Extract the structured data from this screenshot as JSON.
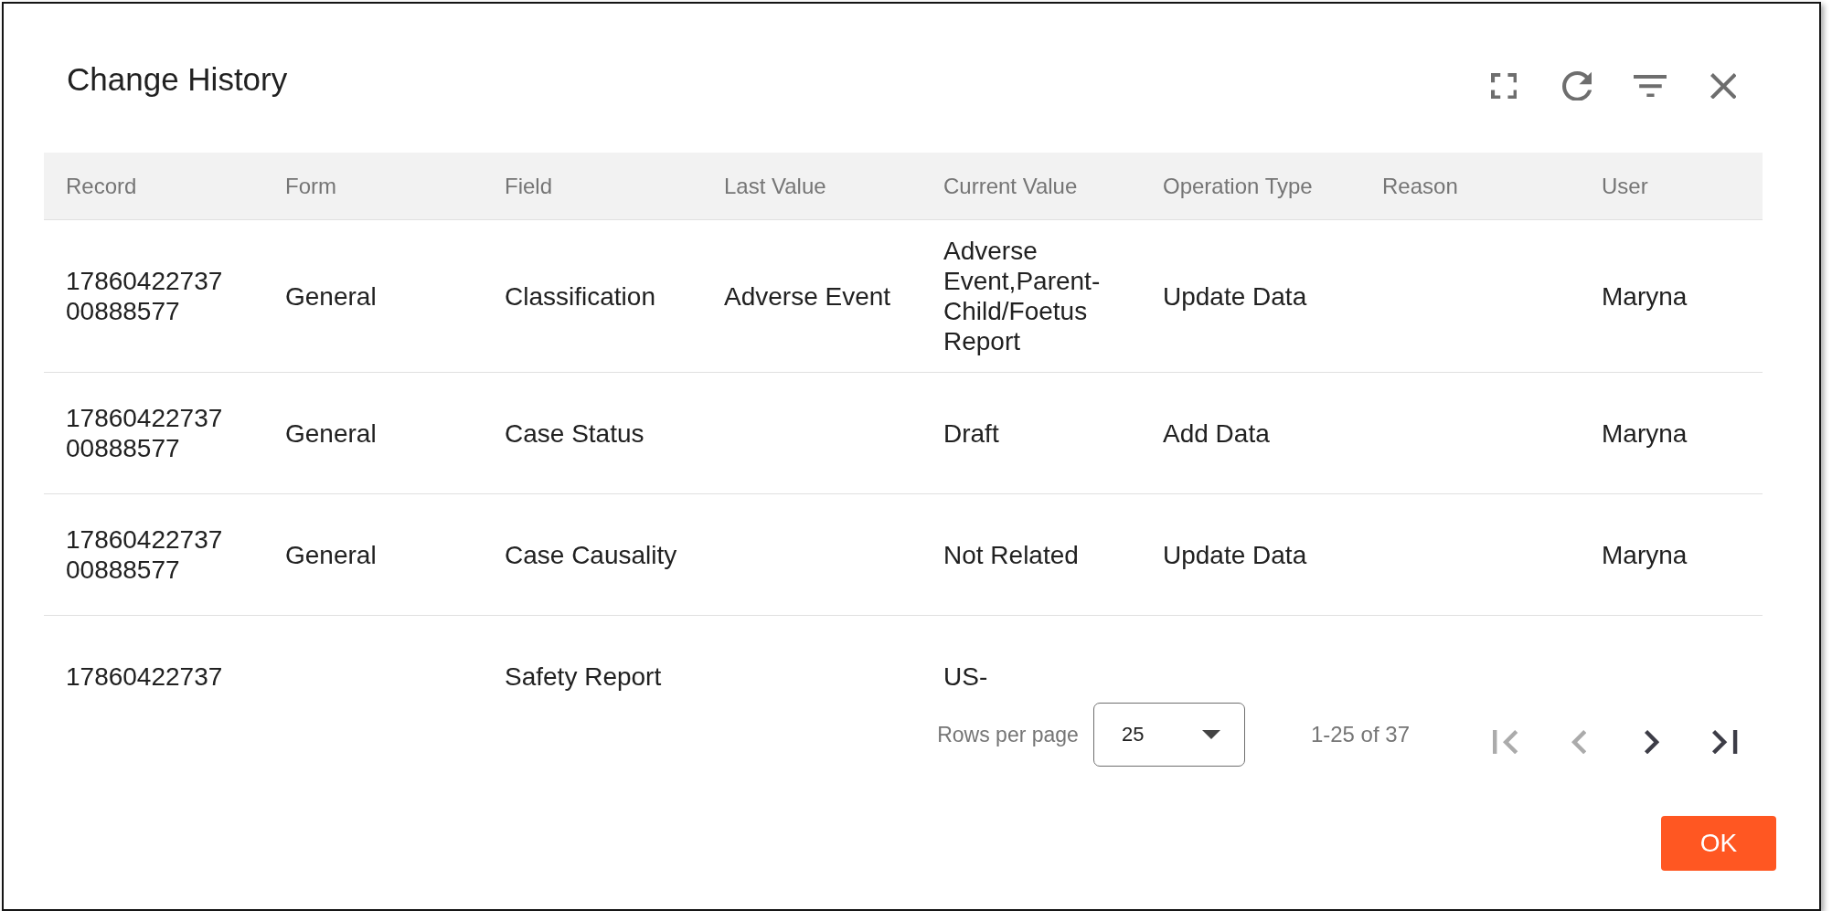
{
  "dialog": {
    "title": "Change History",
    "toolbar": [
      {
        "kind": "fullscreen"
      },
      {
        "kind": "refresh"
      },
      {
        "kind": "filter"
      },
      {
        "kind": "close"
      }
    ]
  },
  "table": {
    "columns": [
      "Record",
      "Form",
      "Field",
      "Last Value",
      "Current Value",
      "Operation Type",
      "Reason",
      "User"
    ],
    "rows": [
      {
        "record": "1786042273700888577",
        "form": "General",
        "field": "Classification",
        "last_value": "Adverse Event",
        "current_value": "Adverse Event,Parent-Child/Foetus Report",
        "operation_type": "Update Data",
        "user": "Maryna"
      },
      {
        "record": "1786042273700888577",
        "form": "General",
        "field": "Case Status",
        "current_value": "Draft",
        "operation_type": "Add Data",
        "user": "Maryna"
      },
      {
        "record": "1786042273700888577",
        "form": "General",
        "field": "Case Causality",
        "current_value": "Not Related",
        "operation_type": "Update Data",
        "user": "Maryna"
      },
      {
        "record": "17860422737",
        "field": "Safety Report",
        "current_value": "US-"
      }
    ]
  },
  "pagination": {
    "rows_per_page_label": "Rows per page",
    "rows_per_page": "25",
    "range": "1-25 of 37",
    "buttons": [
      {
        "kind": "first",
        "disabled": true
      },
      {
        "kind": "previous",
        "disabled": true
      },
      {
        "kind": "next",
        "disabled": false
      },
      {
        "kind": "last",
        "disabled": false
      }
    ]
  },
  "footer": {
    "ok_button": "OK"
  }
}
